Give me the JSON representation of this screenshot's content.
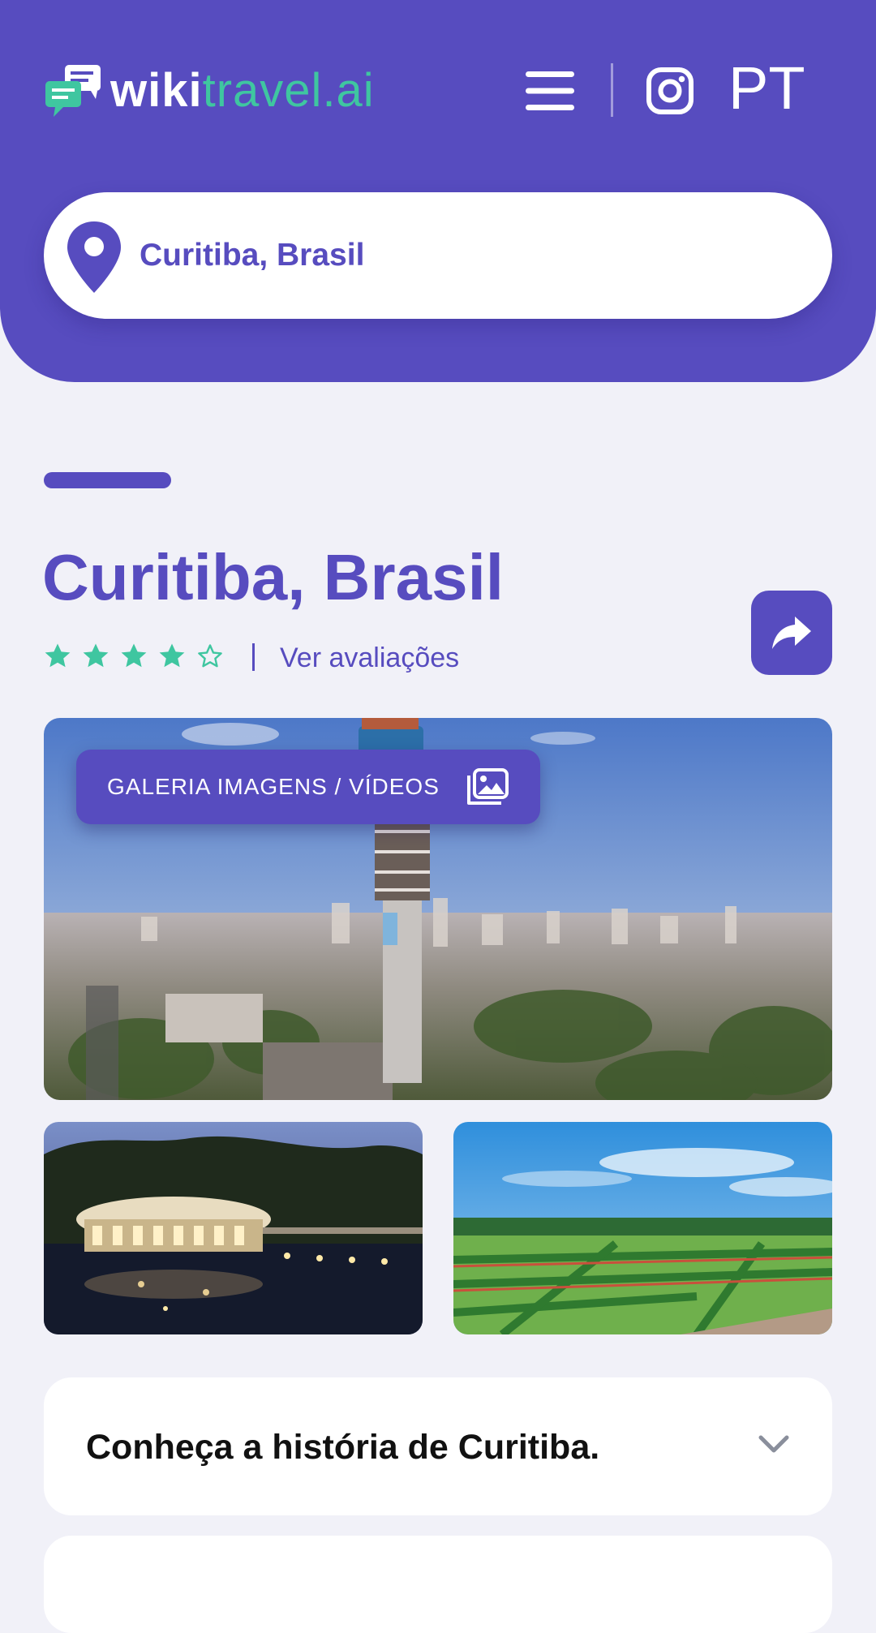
{
  "header": {
    "logo": {
      "wiki": "wiki",
      "travel": "travel.ai"
    },
    "language": "PT",
    "menu_icon": "hamburger-menu-icon",
    "social_icon": "instagram-icon",
    "background_color": "#574cbf"
  },
  "search": {
    "value": "Curitiba, Brasil",
    "icon": "location-pin-icon"
  },
  "destination": {
    "title": "Curitiba, Brasil",
    "rating": 4,
    "rating_max": 5,
    "reviews_link": "Ver avaliações",
    "share_icon": "share-arrow-icon"
  },
  "gallery": {
    "button_label": "GALERIA IMAGENS / VÍDEOS",
    "button_icon": "image-gallery-icon"
  },
  "accordion": {
    "items": [
      {
        "label": "Conheça a história de Curitiba."
      }
    ],
    "chevron_icon": "chevron-down-icon"
  },
  "colors": {
    "primary": "#574cbf",
    "accent_green": "#3fc6a0",
    "background": "#f1f1f8"
  }
}
